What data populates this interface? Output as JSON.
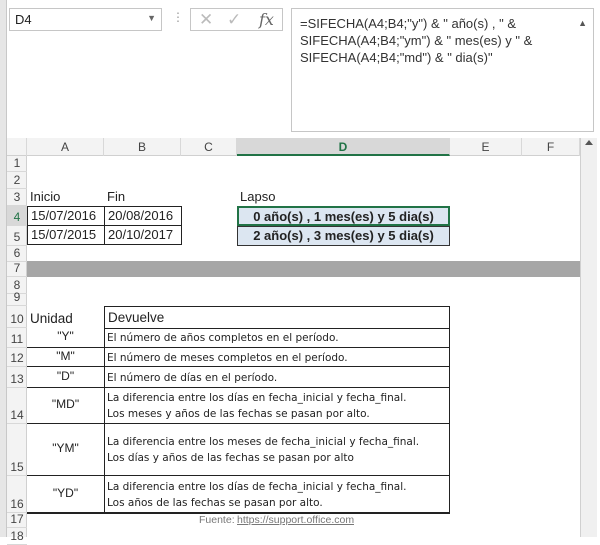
{
  "name_box": "D4",
  "formula_bar": {
    "cancel_icon": "x-icon",
    "enter_icon": "check-icon",
    "fx_label": "fx",
    "lines": [
      "=SIFECHA(A4;B4;\"y\") & \" año(s) , \" &",
      "SIFECHA(A4;B4;\"ym\") & \" mes(es) y \" &",
      "SIFECHA(A4;B4;\"md\") & \" dia(s)\""
    ]
  },
  "columns": [
    "A",
    "B",
    "C",
    "D",
    "E",
    "F"
  ],
  "rows": [
    "1",
    "2",
    "3",
    "4",
    "5",
    "6",
    "7",
    "8",
    "9",
    "10",
    "11",
    "12",
    "13",
    "14",
    "15",
    "16",
    "17",
    "18"
  ],
  "headers": {
    "inicio": "Inicio",
    "fin": "Fin",
    "lapso": "Lapso"
  },
  "dates": [
    {
      "inicio": "15/07/2016",
      "fin": "20/08/2016",
      "lapso": "0 año(s) , 1 mes(es) y 5 dia(s)"
    },
    {
      "inicio": "15/07/2015",
      "fin": "20/10/2017",
      "lapso": "2 año(s) , 3 mes(es) y 5 dia(s)"
    }
  ],
  "table": {
    "col_unidad": "Unidad",
    "col_devuelve": "Devuelve",
    "rows": [
      {
        "unit": "\"Y\"",
        "lines": [
          "El número de años completos en el período."
        ]
      },
      {
        "unit": "\"M\"",
        "lines": [
          "El número de meses completos en el período."
        ]
      },
      {
        "unit": "\"D\"",
        "lines": [
          "El número de días en el período."
        ]
      },
      {
        "unit": "\"MD\"",
        "lines": [
          "La diferencia entre los días en fecha_inicial y fecha_final.",
          "Los meses y años de las fechas se pasan por alto."
        ]
      },
      {
        "unit": "\"YM\"",
        "lines": [
          "La diferencia entre los meses de fecha_inicial y fecha_final.",
          "Los días y años de las fechas se pasan por alto"
        ]
      },
      {
        "unit": "\"YD\"",
        "lines": [
          "La diferencia entre los días de fecha_inicial y fecha_final.",
          "Los años de las fechas se pasan por alto."
        ]
      }
    ]
  },
  "source": {
    "label": "Fuente:",
    "link": "https://support.office.com"
  },
  "colors": {
    "selection": "#217346",
    "lapso_fill": "#dce6f1",
    "separator": "#a6a6a6"
  }
}
